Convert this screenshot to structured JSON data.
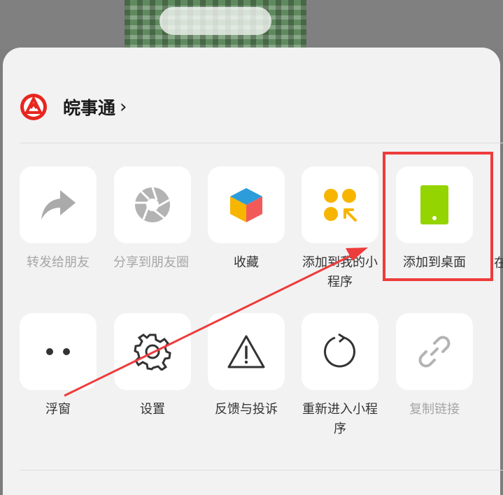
{
  "header": {
    "title": "皖事通",
    "chevron": "›"
  },
  "row1": [
    {
      "label": "转发给朋友",
      "icon": "share-arrow-icon"
    },
    {
      "label": "分享到朋友圈",
      "icon": "camera-aperture-icon"
    },
    {
      "label": "收藏",
      "icon": "cube-icon"
    },
    {
      "label": "添加到我的小程序",
      "icon": "miniprogram-add-icon"
    },
    {
      "label": "添加到桌面",
      "icon": "phone-icon"
    }
  ],
  "row1_partial": "在",
  "row2": [
    {
      "label": "浮窗",
      "icon": "float-window-icon"
    },
    {
      "label": "设置",
      "icon": "gear-icon"
    },
    {
      "label": "反馈与投诉",
      "icon": "warning-icon"
    },
    {
      "label": "重新进入小程序",
      "icon": "refresh-icon"
    },
    {
      "label": "复制链接",
      "icon": "link-icon"
    }
  ],
  "colors": {
    "accent_red": "#ee3b3b",
    "phone_green": "#94d400",
    "yellow": "#f7b500"
  }
}
